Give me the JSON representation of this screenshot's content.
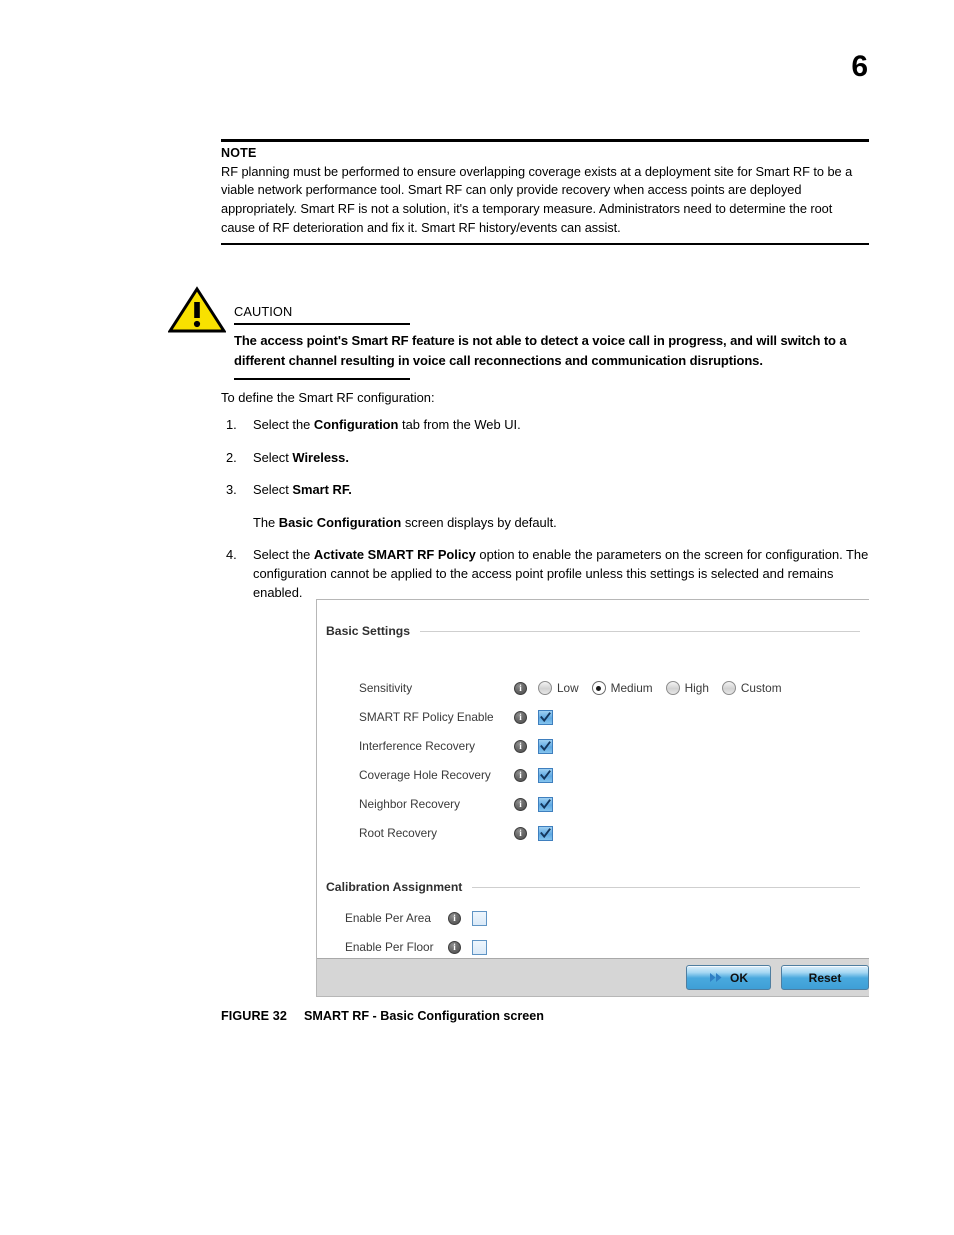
{
  "page": {
    "number": "6"
  },
  "note": {
    "title": "NOTE",
    "body": "RF planning must be performed to ensure overlapping coverage exists at a deployment site for Smart RF to be a viable network performance tool. Smart RF can only provide recovery when access points are deployed appropriately. Smart RF is not a solution, it's a temporary measure. Administrators need to determine the root cause of RF deterioration and fix it. Smart RF history/events can assist."
  },
  "caution": {
    "icon": "warning-triangle-icon",
    "title": "CAUTION",
    "body": "The access point's Smart RF feature is not able to detect a voice call in progress, and will switch to a different channel resulting in voice call reconnections and communication disruptions."
  },
  "procedure": {
    "intro": "To define the Smart RF configuration:",
    "steps": [
      {
        "num": "1.",
        "parts": [
          {
            "text": "Select the ",
            "bold": false
          },
          {
            "text": "Configuration",
            "bold": true
          },
          {
            "text": " tab from the Web UI.",
            "bold": false
          }
        ]
      },
      {
        "num": "2.",
        "parts": [
          {
            "text": "Select ",
            "bold": false
          },
          {
            "text": "Wireless.",
            "bold": true
          }
        ]
      },
      {
        "num": "3.",
        "parts": [
          {
            "text": "Select ",
            "bold": false
          },
          {
            "text": "Smart RF.",
            "bold": true
          }
        ]
      },
      {
        "num": "",
        "parts": [
          {
            "text": "The ",
            "bold": false
          },
          {
            "text": "Basic Configuration",
            "bold": true
          },
          {
            "text": " screen displays by default.",
            "bold": false
          }
        ]
      },
      {
        "num": "4.",
        "parts": [
          {
            "text": "Select the ",
            "bold": false
          },
          {
            "text": "Activate SMART RF Policy",
            "bold": true
          },
          {
            "text": " option to enable the parameters on the screen for configuration. The configuration cannot be applied to the access point profile unless this settings is selected and remains enabled.",
            "bold": false
          }
        ]
      }
    ]
  },
  "ui_screenshot": {
    "sections": [
      {
        "id": "basic-settings",
        "title": "Basic Settings"
      },
      {
        "id": "calibration-assignment",
        "title": "Calibration Assignment"
      }
    ],
    "sensitivity": {
      "label": "Sensitivity",
      "info_icon": "info-icon",
      "options": [
        {
          "label": "Low",
          "selected": false
        },
        {
          "label": "Medium",
          "selected": true
        },
        {
          "label": "High",
          "selected": false
        },
        {
          "label": "Custom",
          "selected": false
        }
      ],
      "selected_value": "Medium"
    },
    "basic_rows": [
      {
        "label": "SMART RF Policy Enable",
        "checked": true
      },
      {
        "label": "Interference Recovery",
        "checked": true
      },
      {
        "label": "Coverage Hole Recovery",
        "checked": true
      },
      {
        "label": "Neighbor Recovery",
        "checked": true
      },
      {
        "label": "Root Recovery",
        "checked": true
      }
    ],
    "calibration_rows": [
      {
        "label": "Enable Per Area",
        "checked": false
      },
      {
        "label": "Enable Per Floor",
        "checked": false
      }
    ],
    "buttons": {
      "ok": "OK",
      "reset": "Reset"
    },
    "colors": {
      "checkbox_checked": "#5fa9e2",
      "button_blue": "#4aa9de",
      "footer_gray": "#d6d6d6",
      "caution_yellow": "#f8e100"
    }
  },
  "figure": {
    "number": "FIGURE 32",
    "caption": "SMART RF - Basic Configuration screen"
  }
}
